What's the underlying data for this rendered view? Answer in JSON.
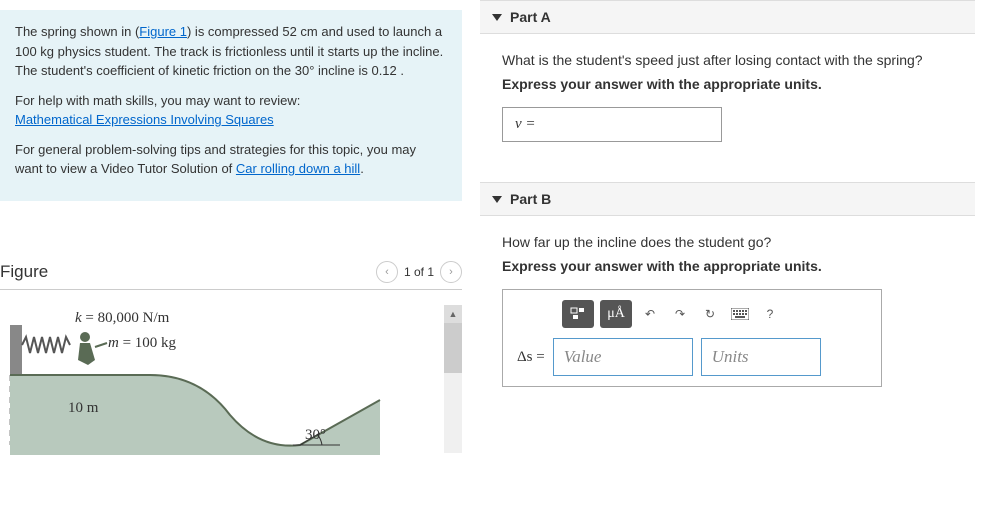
{
  "problem": {
    "para1_pre": "The spring shown in (",
    "figure_link": "Figure 1",
    "para1_post": ") is compressed 52 cm and used to launch a 100 kg physics student. The track is frictionless until it starts up the incline. The student's coefficient of kinetic friction on the 30° incline is 0.12 .",
    "para2_pre": "For help with math skills, you may want to review:",
    "math_link": "Mathematical Expressions Involving Squares",
    "para3_pre": "For general problem-solving tips and strategies for this topic, you may want to view a Video Tutor Solution of",
    "video_link": "Car rolling down a hill",
    "video_post": "."
  },
  "figure": {
    "title": "Figure",
    "pager": "1 of 1",
    "k_label": "k = 80,000 N/m",
    "m_label": "m = 100 kg",
    "height": "10 m",
    "angle": "30°"
  },
  "partA": {
    "title": "Part A",
    "question": "What is the student's speed just after losing contact with the spring?",
    "instruction": "Express your answer with the appropriate units.",
    "var": "v ="
  },
  "partB": {
    "title": "Part B",
    "question": "How far up the incline does the student go?",
    "instruction": "Express your answer with the appropriate units.",
    "mua": "μÅ",
    "help": "?",
    "delta": "Δs =",
    "value_placeholder": "Value",
    "units_placeholder": "Units"
  }
}
